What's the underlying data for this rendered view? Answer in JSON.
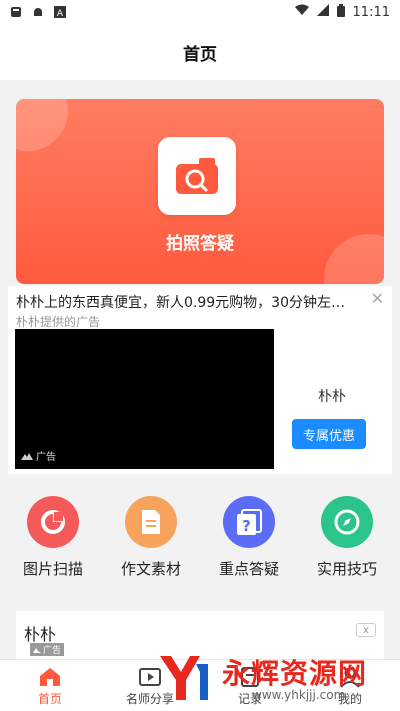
{
  "status_bar": {
    "time": "11:11",
    "left_icons": [
      "notification-icon",
      "android-icon",
      "a-icon"
    ],
    "right_icons": [
      "wifi-icon",
      "signal-icon",
      "battery-icon"
    ]
  },
  "header": {
    "title": "首页"
  },
  "banner": {
    "label": "拍照答疑",
    "icon": "camera-search-icon"
  },
  "ad1": {
    "title": "朴朴上的东西真便宜，新人0.99元购物，30分钟左…",
    "subtitle": "朴朴提供的广告",
    "tag": "广告",
    "brand": "朴朴",
    "button": "专属优惠"
  },
  "tools": [
    {
      "label": "图片扫描",
      "icon": "scan-icon",
      "color": "#f55a5a"
    },
    {
      "label": "作文素材",
      "icon": "document-icon",
      "color": "#f7a35c"
    },
    {
      "label": "重点答疑",
      "icon": "question-icon",
      "color": "#5b6cf6"
    },
    {
      "label": "实用技巧",
      "icon": "compass-icon",
      "color": "#2bc48a"
    }
  ],
  "ad2": {
    "title": "朴朴",
    "tag": "广告",
    "close": "x"
  },
  "tabbar": {
    "tabs": [
      {
        "label": "首页",
        "icon": "home-icon",
        "active": true
      },
      {
        "label": "名师分享",
        "icon": "play-icon",
        "active": false
      },
      {
        "label": "记录",
        "icon": "record-icon",
        "active": false
      },
      {
        "label": "我的",
        "icon": "user-icon",
        "active": false
      }
    ]
  },
  "watermark": {
    "text": "永辉资源网",
    "url": "www.yhkjjj.com"
  },
  "colors": {
    "accent": "#ff5a3d",
    "primary_button": "#1a8cff"
  }
}
